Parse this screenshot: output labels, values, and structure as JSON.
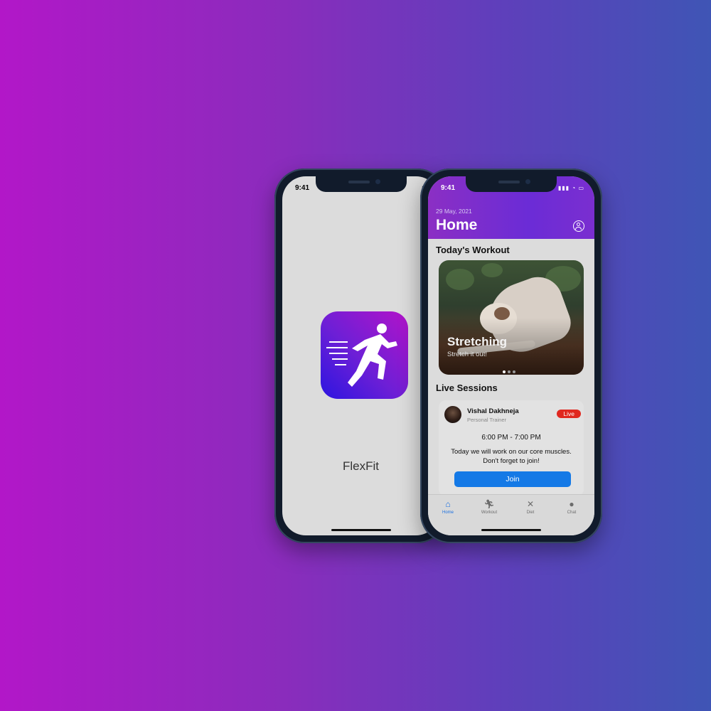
{
  "splash": {
    "status_time": "9:41",
    "app_name": "FlexFit"
  },
  "home": {
    "status_time": "9:41",
    "status_icons": "▮▮▮ ◔ ▭",
    "date": "29 May, 2021",
    "title": "Home",
    "todays_workout_heading": "Today's Workout",
    "workout": {
      "title": "Stretching",
      "subtitle": "Stretch it out!",
      "carousel_pages": 3,
      "active_page": 1
    },
    "live_sessions_heading": "Live Sessions",
    "session": {
      "trainer_name": "Vishal Dakhneja",
      "trainer_role": "Personal Trainer",
      "badge": "Live",
      "time": "6:00 PM - 7:00 PM",
      "description": "Today we will work on our core muscles. Don't forget to join!",
      "join_label": "Join"
    },
    "tabs": [
      {
        "label": "Home",
        "icon": "home-icon",
        "active": true
      },
      {
        "label": "Workout",
        "icon": "runner-icon",
        "active": false
      },
      {
        "label": "Diet",
        "icon": "utensils-icon",
        "active": false
      },
      {
        "label": "Chat",
        "icon": "chat-bubble-icon",
        "active": false
      }
    ]
  },
  "colors": {
    "accent": "#1479e6",
    "header_purple": "#7a2ed0",
    "live_red": "#e0281f"
  }
}
